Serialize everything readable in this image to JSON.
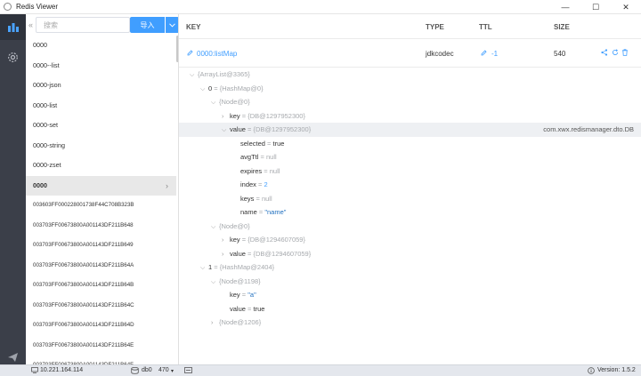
{
  "window": {
    "title": "Redis Viewer",
    "controls": {
      "minimize": "—",
      "maximize": "☐",
      "close": "✕"
    }
  },
  "sidebar": {
    "items": [
      {
        "name": "stats",
        "icon": "bar-chart-icon"
      },
      {
        "name": "settings",
        "icon": "gear-icon"
      },
      {
        "name": "send",
        "icon": "send-icon"
      }
    ]
  },
  "keypanel": {
    "collapse": "«",
    "search_placeholder": "搜索",
    "import_label": "导入",
    "keys": [
      {
        "label": "0000"
      },
      {
        "label": "0000--list"
      },
      {
        "label": "0000-json"
      },
      {
        "label": "0000-list"
      },
      {
        "label": "0000-set"
      },
      {
        "label": "0000-string"
      },
      {
        "label": "0000-zset"
      },
      {
        "label": "0000",
        "selected": true
      },
      {
        "label": "003603FF000228001738F44C708B323B",
        "long": true
      },
      {
        "label": "003703FF00673800A001143DF211B648",
        "long": true
      },
      {
        "label": "003703FF00673800A001143DF211B649",
        "long": true
      },
      {
        "label": "003703FF00673800A001143DF211B64A",
        "long": true
      },
      {
        "label": "003703FF00673800A001143DF211B64B",
        "long": true
      },
      {
        "label": "003703FF00673800A001143DF211B64C",
        "long": true
      },
      {
        "label": "003703FF00673800A001143DF211B64D",
        "long": true
      },
      {
        "label": "003703FF00673800A001143DF211B64E",
        "long": true
      },
      {
        "label": "003703FF00673800A001143DF211B64F",
        "long": true
      }
    ]
  },
  "main": {
    "headers": {
      "key": "KEY",
      "type": "TYPE",
      "ttl": "TTL",
      "size": "SIZE"
    },
    "key": {
      "name": "0000:listMap",
      "type": "jdkcodec",
      "ttl": "-1",
      "size": "540"
    },
    "tree": [
      {
        "indent": 0,
        "caret": "⌵",
        "parts": [
          [
            "gray",
            "{ArrayList@3365}"
          ]
        ]
      },
      {
        "indent": 1,
        "caret": "⌵",
        "parts": [
          [
            "dark",
            "0"
          ],
          [
            "gray",
            " = {HashMap@0}"
          ]
        ]
      },
      {
        "indent": 2,
        "caret": "⌵",
        "parts": [
          [
            "gray",
            "{Node@0}"
          ]
        ]
      },
      {
        "indent": 3,
        "caret": "›",
        "parts": [
          [
            "dark",
            "key"
          ],
          [
            "gray",
            " = {DB@1297952300}"
          ]
        ]
      },
      {
        "indent": 3,
        "caret": "⌵",
        "hl": true,
        "parts": [
          [
            "dark",
            "value"
          ],
          [
            "gray",
            " = {DB@1297952300}"
          ]
        ],
        "right": "com.xwx.redismanager.dto.DB"
      },
      {
        "indent": 4,
        "caret": "",
        "parts": [
          [
            "dark",
            "selected"
          ],
          [
            "gray",
            " = "
          ],
          [
            "dark",
            "true"
          ]
        ]
      },
      {
        "indent": 4,
        "caret": "",
        "parts": [
          [
            "dark",
            "avgTtl"
          ],
          [
            "gray",
            " = null"
          ]
        ]
      },
      {
        "indent": 4,
        "caret": "",
        "parts": [
          [
            "dark",
            "expires"
          ],
          [
            "gray",
            " = null"
          ]
        ]
      },
      {
        "indent": 4,
        "caret": "",
        "parts": [
          [
            "dark",
            "index"
          ],
          [
            "gray",
            " = "
          ],
          [
            "blue",
            "2"
          ]
        ]
      },
      {
        "indent": 4,
        "caret": "",
        "parts": [
          [
            "dark",
            "keys"
          ],
          [
            "gray",
            " = null"
          ]
        ]
      },
      {
        "indent": 4,
        "caret": "",
        "parts": [
          [
            "dark",
            "name"
          ],
          [
            "gray",
            " = "
          ],
          [
            "str",
            "\"name\""
          ]
        ]
      },
      {
        "indent": 2,
        "caret": "⌵",
        "parts": [
          [
            "gray",
            "{Node@0}"
          ]
        ]
      },
      {
        "indent": 3,
        "caret": "›",
        "parts": [
          [
            "dark",
            "key"
          ],
          [
            "gray",
            " = {DB@1294607059}"
          ]
        ]
      },
      {
        "indent": 3,
        "caret": "›",
        "parts": [
          [
            "dark",
            "value"
          ],
          [
            "gray",
            " = {DB@1294607059}"
          ]
        ]
      },
      {
        "indent": 1,
        "caret": "⌵",
        "parts": [
          [
            "dark",
            "1"
          ],
          [
            "gray",
            " = {HashMap@2404}"
          ]
        ]
      },
      {
        "indent": 2,
        "caret": "⌵",
        "parts": [
          [
            "gray",
            "{Node@1198}"
          ]
        ]
      },
      {
        "indent": 3,
        "caret": "",
        "parts": [
          [
            "dark",
            "key"
          ],
          [
            "gray",
            " = "
          ],
          [
            "str",
            "\"a\""
          ]
        ]
      },
      {
        "indent": 3,
        "caret": "",
        "parts": [
          [
            "dark",
            "value"
          ],
          [
            "gray",
            " = "
          ],
          [
            "dark",
            "true"
          ]
        ]
      },
      {
        "indent": 2,
        "caret": "›",
        "parts": [
          [
            "gray",
            "{Node@1206}"
          ]
        ]
      }
    ]
  },
  "statusbar": {
    "host": "10.221.164.114",
    "db": "db0",
    "count": "470",
    "version": "Version: 1.5.2"
  }
}
